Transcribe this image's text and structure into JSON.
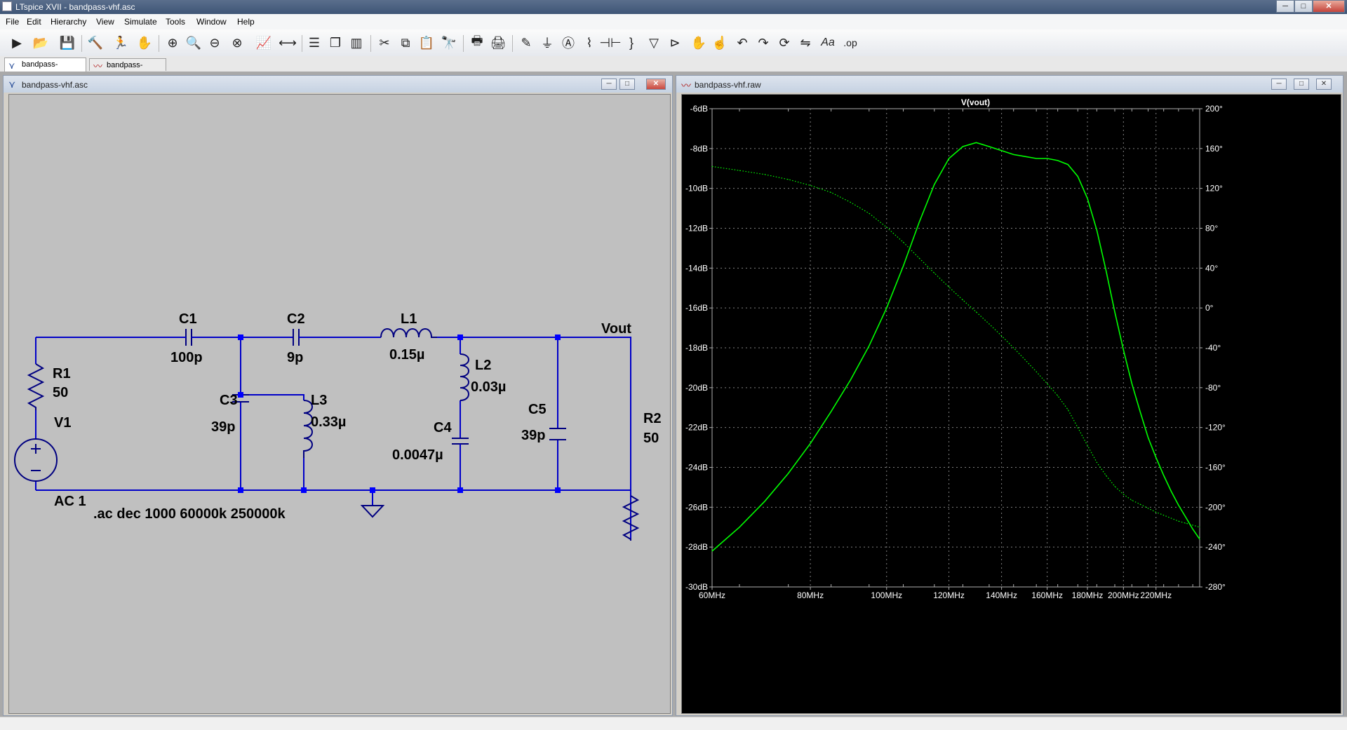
{
  "app": {
    "title": "LTspice XVII - bandpass-vhf.asc"
  },
  "window_buttons": {
    "minimize": "─",
    "maximize": "□",
    "close": "✕"
  },
  "menu": [
    "File",
    "Edit",
    "Hierarchy",
    "View",
    "Simulate",
    "Tools",
    "Window",
    "Help"
  ],
  "toolbar_icons": [
    "run-icon",
    "open-icon",
    "save-icon",
    "hammer-icon",
    "run-man-icon",
    "pan-hand-icon",
    "zoom-in-icon",
    "zoom-fit-icon",
    "zoom-out-icon",
    "zoom-cancel-icon",
    "plot-settings-icon",
    "autorange-icon",
    "tile-horizontal-icon",
    "cascade-icon",
    "tile-vertical-icon",
    "cut-icon",
    "copy-icon",
    "paste-icon",
    "find-icon",
    "print-icon",
    "print-setup-icon",
    "draw-wire-icon",
    "ground-icon",
    "label-net-icon",
    "resistor-icon",
    "capacitor-icon",
    "inductor-icon",
    "diode-icon",
    "component-icon",
    "move-icon",
    "drag-icon",
    "undo-icon",
    "redo-icon",
    "rotate-icon",
    "mirror-icon",
    "text-icon",
    "spice-directive-icon"
  ],
  "tabs": [
    {
      "label": "bandpass-vhf.asc",
      "icon": "schematic-icon",
      "active": true
    },
    {
      "label": "bandpass-vhf.raw",
      "icon": "waveform-icon",
      "active": false
    }
  ],
  "schematic_window": {
    "title": "bandpass-vhf.asc",
    "components": {
      "C1": {
        "name": "C1",
        "value": "100p"
      },
      "C2": {
        "name": "C2",
        "value": "9p"
      },
      "L1": {
        "name": "L1",
        "value": "0.15µ"
      },
      "R1": {
        "name": "R1",
        "value": "50"
      },
      "V1": {
        "name": "V1",
        "value": "AC 1"
      },
      "C3": {
        "name": "C3",
        "value": "39p"
      },
      "L3": {
        "name": "L3",
        "value": "0.33µ"
      },
      "L2": {
        "name": "L2",
        "value": "0.03µ"
      },
      "C4": {
        "name": "C4",
        "value": "0.0047µ"
      },
      "C5": {
        "name": "C5",
        "value": "39p"
      },
      "R2": {
        "name": "R2",
        "value": "50"
      }
    },
    "net_label": "Vout",
    "directive": ".ac dec 1000 60000k 250000k",
    "colors": {
      "wire": "#0000c8",
      "junction": "#0000ff",
      "background": "#c0c0c0"
    }
  },
  "plot_window": {
    "title": "bandpass-vhf.raw"
  },
  "chart_data": {
    "type": "line",
    "title": "V(vout)",
    "x_scale": "log",
    "x_range_hz": [
      60000000,
      250000000
    ],
    "x_tick_labels": [
      "60MHz",
      "80MHz",
      "100MHz",
      "120MHz",
      "140MHz",
      "160MHz",
      "180MHz",
      "200MHz",
      "220MHz"
    ],
    "x_tick_values_mhz": [
      60,
      80,
      100,
      120,
      140,
      160,
      180,
      200,
      220
    ],
    "y_left": {
      "range": [
        -30,
        -6
      ],
      "unit": "dB",
      "tick_labels": [
        "-6dB",
        "-8dB",
        "-10dB",
        "-12dB",
        "-14dB",
        "-16dB",
        "-18dB",
        "-20dB",
        "-22dB",
        "-24dB",
        "-26dB",
        "-28dB",
        "-30dB"
      ]
    },
    "y_right": {
      "range": [
        -280,
        200
      ],
      "unit": "°",
      "tick_labels": [
        "200°",
        "160°",
        "120°",
        "80°",
        "40°",
        "0°",
        "-40°",
        "-80°",
        "-120°",
        "-160°",
        "-200°",
        "-240°",
        "-280°"
      ]
    },
    "grid": true,
    "series": [
      {
        "name": "V(vout)",
        "quantity": "magnitude",
        "axis": "left",
        "style": "solid",
        "color": "#00ff00",
        "x_mhz": [
          60,
          65,
          70,
          75,
          80,
          85,
          90,
          95,
          100,
          105,
          110,
          115,
          120,
          125,
          130,
          135,
          140,
          145,
          150,
          155,
          160,
          165,
          170,
          175,
          180,
          185,
          190,
          195,
          200,
          205,
          210,
          215,
          220,
          225,
          230,
          235,
          240,
          245,
          250
        ],
        "values": [
          -28.2,
          -27.0,
          -25.7,
          -24.3,
          -22.8,
          -21.2,
          -19.6,
          -17.9,
          -16.0,
          -13.9,
          -11.7,
          -9.8,
          -8.5,
          -7.9,
          -7.7,
          -7.9,
          -8.1,
          -8.3,
          -8.4,
          -8.5,
          -8.5,
          -8.6,
          -8.8,
          -9.4,
          -10.5,
          -12.1,
          -14.1,
          -16.2,
          -18.1,
          -19.8,
          -21.2,
          -22.5,
          -23.5,
          -24.4,
          -25.2,
          -25.9,
          -26.5,
          -27.1,
          -27.6
        ]
      },
      {
        "name": "V(vout)",
        "quantity": "phase",
        "axis": "right",
        "style": "dotted",
        "color": "#00ff00",
        "x_mhz": [
          60,
          65,
          70,
          75,
          80,
          85,
          90,
          95,
          100,
          105,
          110,
          115,
          120,
          125,
          130,
          135,
          140,
          145,
          150,
          155,
          160,
          165,
          170,
          175,
          180,
          185,
          190,
          195,
          200,
          205,
          210,
          215,
          220,
          225,
          230,
          235,
          240,
          245,
          250
        ],
        "values": [
          142,
          138,
          134,
          129,
          123,
          116,
          106,
          95,
          81,
          66,
          50,
          35,
          21,
          8,
          -4,
          -16,
          -28,
          -40,
          -52,
          -64,
          -76,
          -88,
          -102,
          -120,
          -138,
          -155,
          -168,
          -179,
          -187,
          -193,
          -197,
          -201,
          -205,
          -208,
          -211,
          -214,
          -216,
          -218,
          -220
        ]
      }
    ]
  }
}
